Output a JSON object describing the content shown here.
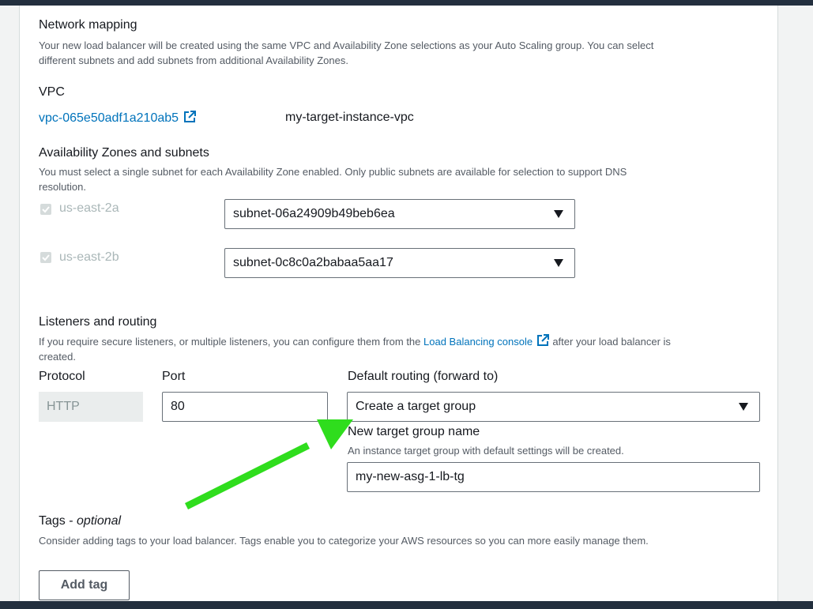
{
  "network": {
    "title": "Network mapping",
    "description_line1": "Your new load balancer will be created using the same VPC and Availability Zone selections as your Auto Scaling group. You can select",
    "description_line2": "different subnets and add subnets from additional Availability Zones.",
    "vpc_label": "VPC",
    "vpc_id": "vpc-065e50adf1a210ab5",
    "vpc_name": "my-target-instance-vpc"
  },
  "zones": {
    "title": "Availability Zones and subnets",
    "description_line1": "You must select a single subnet for each Availability Zone enabled. Only public subnets are available for selection to support DNS",
    "description_line2": "resolution.",
    "items": [
      {
        "zone": "us-east-2a",
        "checked": true,
        "subnet": "subnet-06a24909b49beb6ea"
      },
      {
        "zone": "us-east-2b",
        "checked": true,
        "subnet": "subnet-0c8c0a2babaa5aa17"
      }
    ]
  },
  "listeners": {
    "title": "Listeners and routing",
    "description_pre": "If you require secure listeners, or multiple listeners, you can configure them from the",
    "console_link": "Load Balancing console",
    "description_post": "after your load balancer is",
    "description_line2": "created.",
    "protocol_label": "Protocol",
    "protocol_value": "HTTP",
    "port_label": "Port",
    "port_value": "80",
    "routing_label": "Default routing (forward to)",
    "routing_value": "Create a target group",
    "tg_name_label": "New target group name",
    "tg_name_desc": "An instance target group with default settings will be created.",
    "tg_name_value": "my-new-asg-1-lb-tg"
  },
  "tags": {
    "title": "Tags",
    "optional": "optional",
    "separator": " - ",
    "description": "Consider adding tags to your load balancer. Tags enable you to categorize your AWS resources so you can more easily manage them.",
    "add_tag_label": "Add tag"
  },
  "colors": {
    "link": "#0073bb",
    "annotation_arrow": "#2fdd1d",
    "header_bar": "#232f3e"
  }
}
